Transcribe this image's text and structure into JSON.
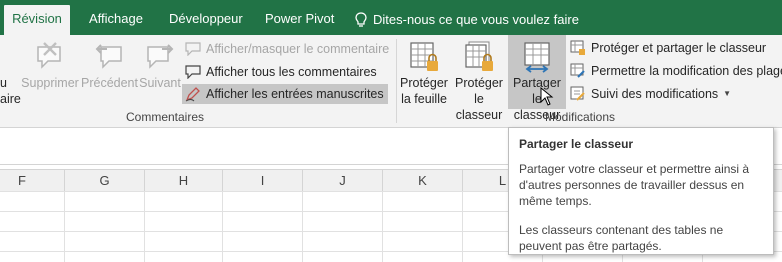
{
  "tabs": [
    {
      "label": "Révision",
      "active": true
    },
    {
      "label": "Affichage"
    },
    {
      "label": "Développeur"
    },
    {
      "label": "Power Pivot"
    }
  ],
  "tell_me": "Dites-nous ce que vous voulez faire",
  "ribbon": {
    "cut_left_1": "u",
    "cut_left_2": "aire",
    "delete_label": "Supprimer",
    "previous_label": "Précédent",
    "next_label": "Suivant",
    "toggle_comment_label": "Afficher/masquer le commentaire",
    "show_all_comments_label": "Afficher tous les commentaires",
    "show_ink_label": "Afficher les entrées manuscrites",
    "comments_group": "Commentaires",
    "protect_sheet_l1": "Protéger",
    "protect_sheet_l2": "la feuille",
    "protect_workbook_l1": "Protéger",
    "protect_workbook_l2": "le classeur",
    "share_workbook_l1": "Partager",
    "share_workbook_l2": "le classeur",
    "protect_share_label": "Protéger et partager le classeur",
    "allow_edit_ranges_label": "Permettre la modification des plages",
    "track_changes_label": "Suivi des modifications",
    "changes_group": "Modifications"
  },
  "columns": [
    "F",
    "G",
    "H",
    "I",
    "J",
    "K",
    "L"
  ],
  "tooltip": {
    "title": "Partager le classeur",
    "para1": "Partager votre classeur et permettre ainsi à d'autres personnes de travailler dessus en même temps.",
    "para2": "Les classeurs contenant des tables ne peuvent pas être partagés."
  },
  "colors": {
    "accent": "#217346",
    "ribbon_bg": "#f3f3f3",
    "pressed": "#c6c6c6"
  }
}
